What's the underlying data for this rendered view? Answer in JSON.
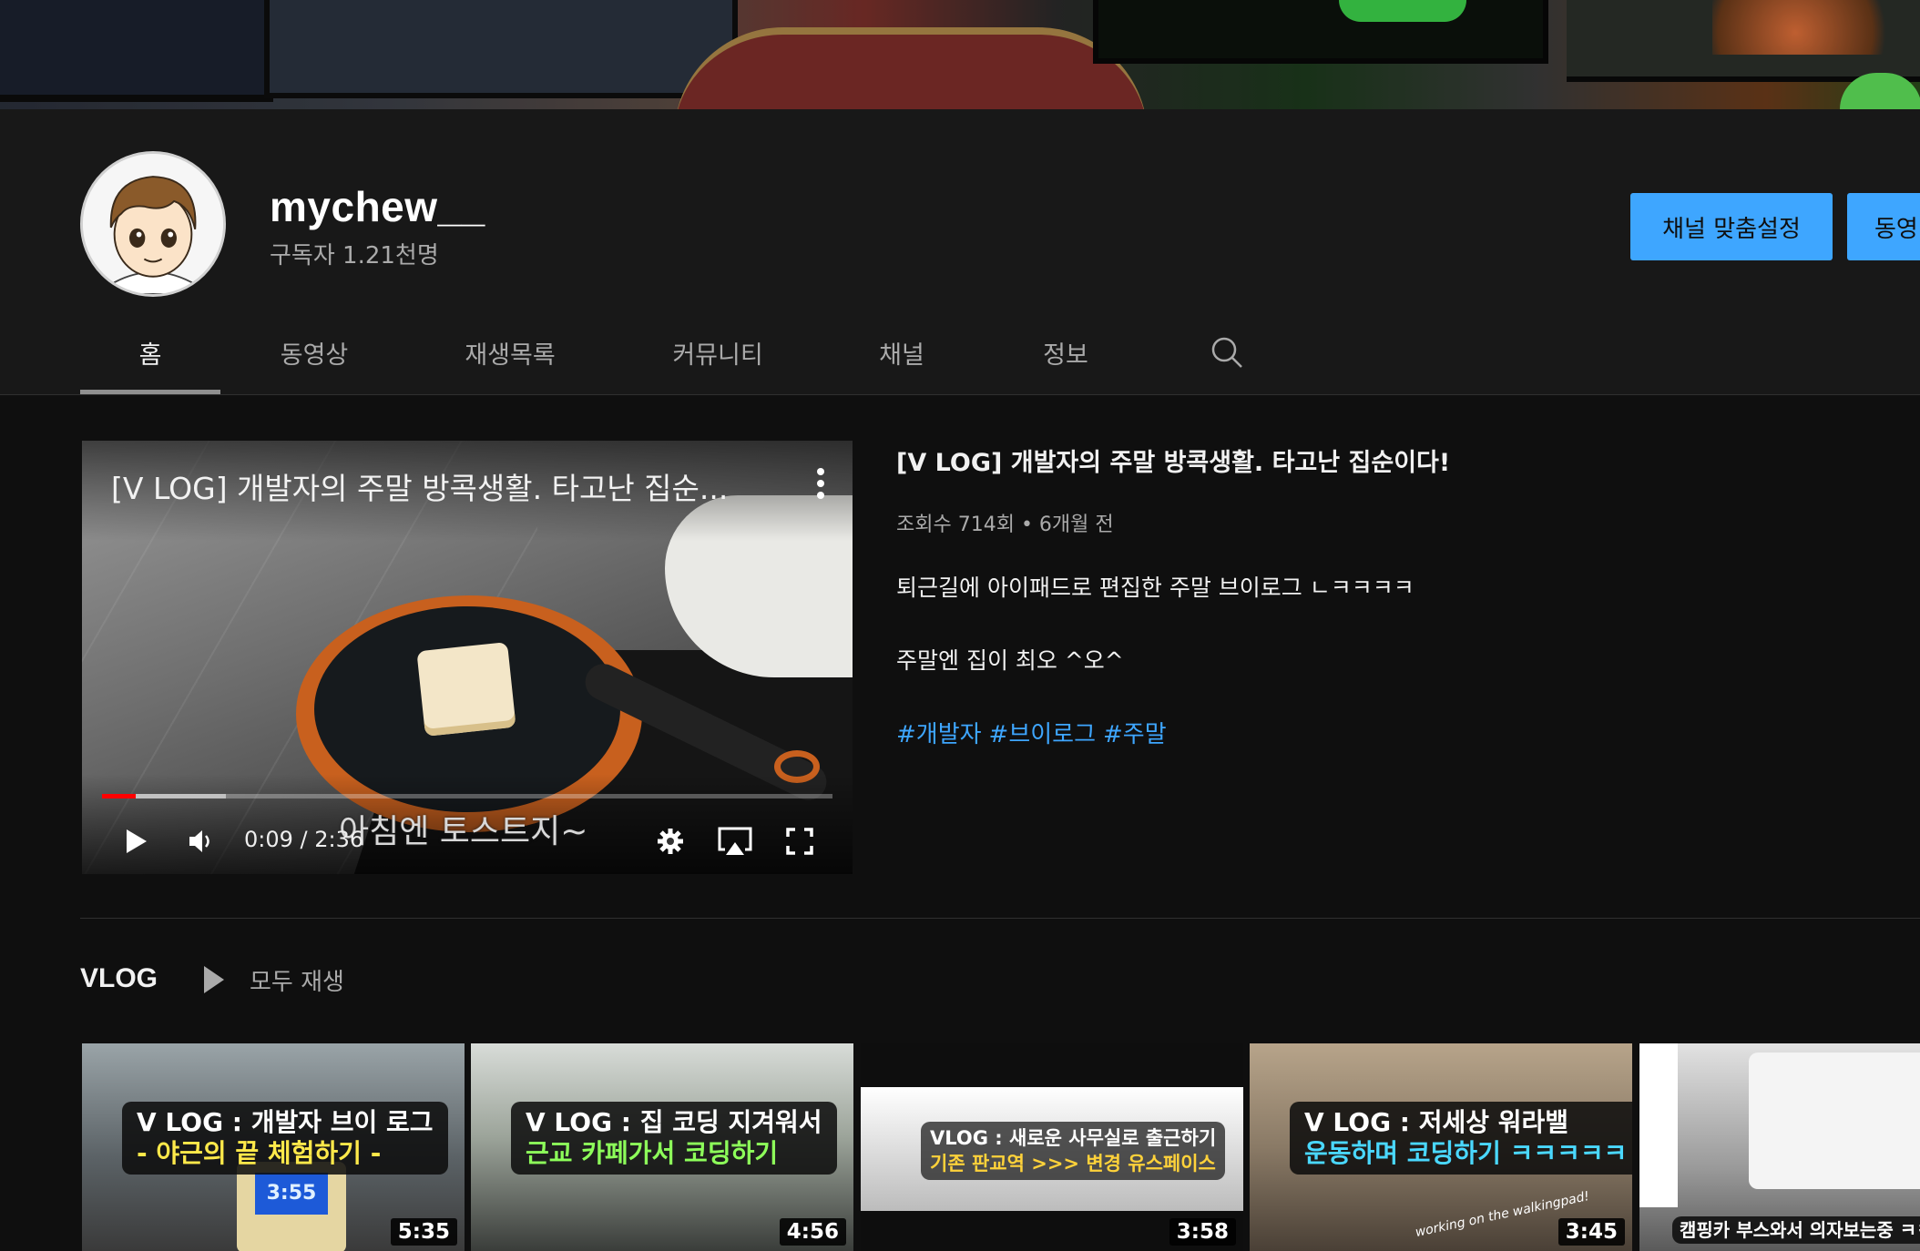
{
  "channel": {
    "name": "mychew__",
    "subscribers": "구독자 1.21천명",
    "customize_button": "채널 맞춤설정",
    "manage_button": "동영"
  },
  "tabs": [
    {
      "label": "홈",
      "active": true
    },
    {
      "label": "동영상"
    },
    {
      "label": "재생목록"
    },
    {
      "label": "커뮤니티"
    },
    {
      "label": "채널"
    },
    {
      "label": "정보"
    }
  ],
  "featured": {
    "player_title": "[V LOG] 개발자의 주말 방콕생활. 타고난 집순...",
    "subtitle": "아침엔 토스트지~",
    "time": "0:09 / 2:36",
    "progress_played": 0.046,
    "progress_buffered": 0.17,
    "title": "[V LOG] 개발자의 주말 방콕생활. 타고난 집순이다!",
    "meta": "조회수 714회 • 6개월 전",
    "desc_line1": "퇴근길에 아이패드로 편집한 주말 브이로그 ㄴㅋㅋㅋㅋ",
    "desc_line2": "주말엔 집이 최오 ^오^",
    "hashtags": [
      "#개발자",
      "#브이로그",
      "#주말"
    ]
  },
  "shelf": {
    "title": "VLOG",
    "play_all": "모두 재생",
    "videos": [
      {
        "cap1": "V LOG : 개발자 브이 로그",
        "cap2": "- 야근의 끝 체험하기 -",
        "screen": "3:55",
        "duration": "5:35"
      },
      {
        "cap1": "V LOG : 집 코딩 지겨워서",
        "cap2": "근교 카페가서 코딩하기",
        "duration": "4:56"
      },
      {
        "cap1": "VLOG : 새로운 사무실로 출근하기",
        "cap2": "기존 판교역 >>> 변경 유스페이스",
        "duration": "3:58"
      },
      {
        "cap1": "V LOG : 저세상 워라밸",
        "cap2": "운동하며 코딩하기 ㅋㅋㅋㅋㅋ",
        "tag": "working on the walkingpad!",
        "duration": "3:45"
      },
      {
        "cap1": "캠핑카 부스와서 의자보는중 ㅋㅋ"
      }
    ]
  },
  "colors": {
    "accent": "#3ea6ff",
    "progress": "#ff0000",
    "background": "#0f0f0f",
    "header_bg": "#181818"
  },
  "icons": [
    "search-icon",
    "more-vert-icon",
    "play-icon",
    "volume-icon",
    "settings-icon",
    "airplay-icon",
    "fullscreen-icon",
    "play-all-icon"
  ]
}
